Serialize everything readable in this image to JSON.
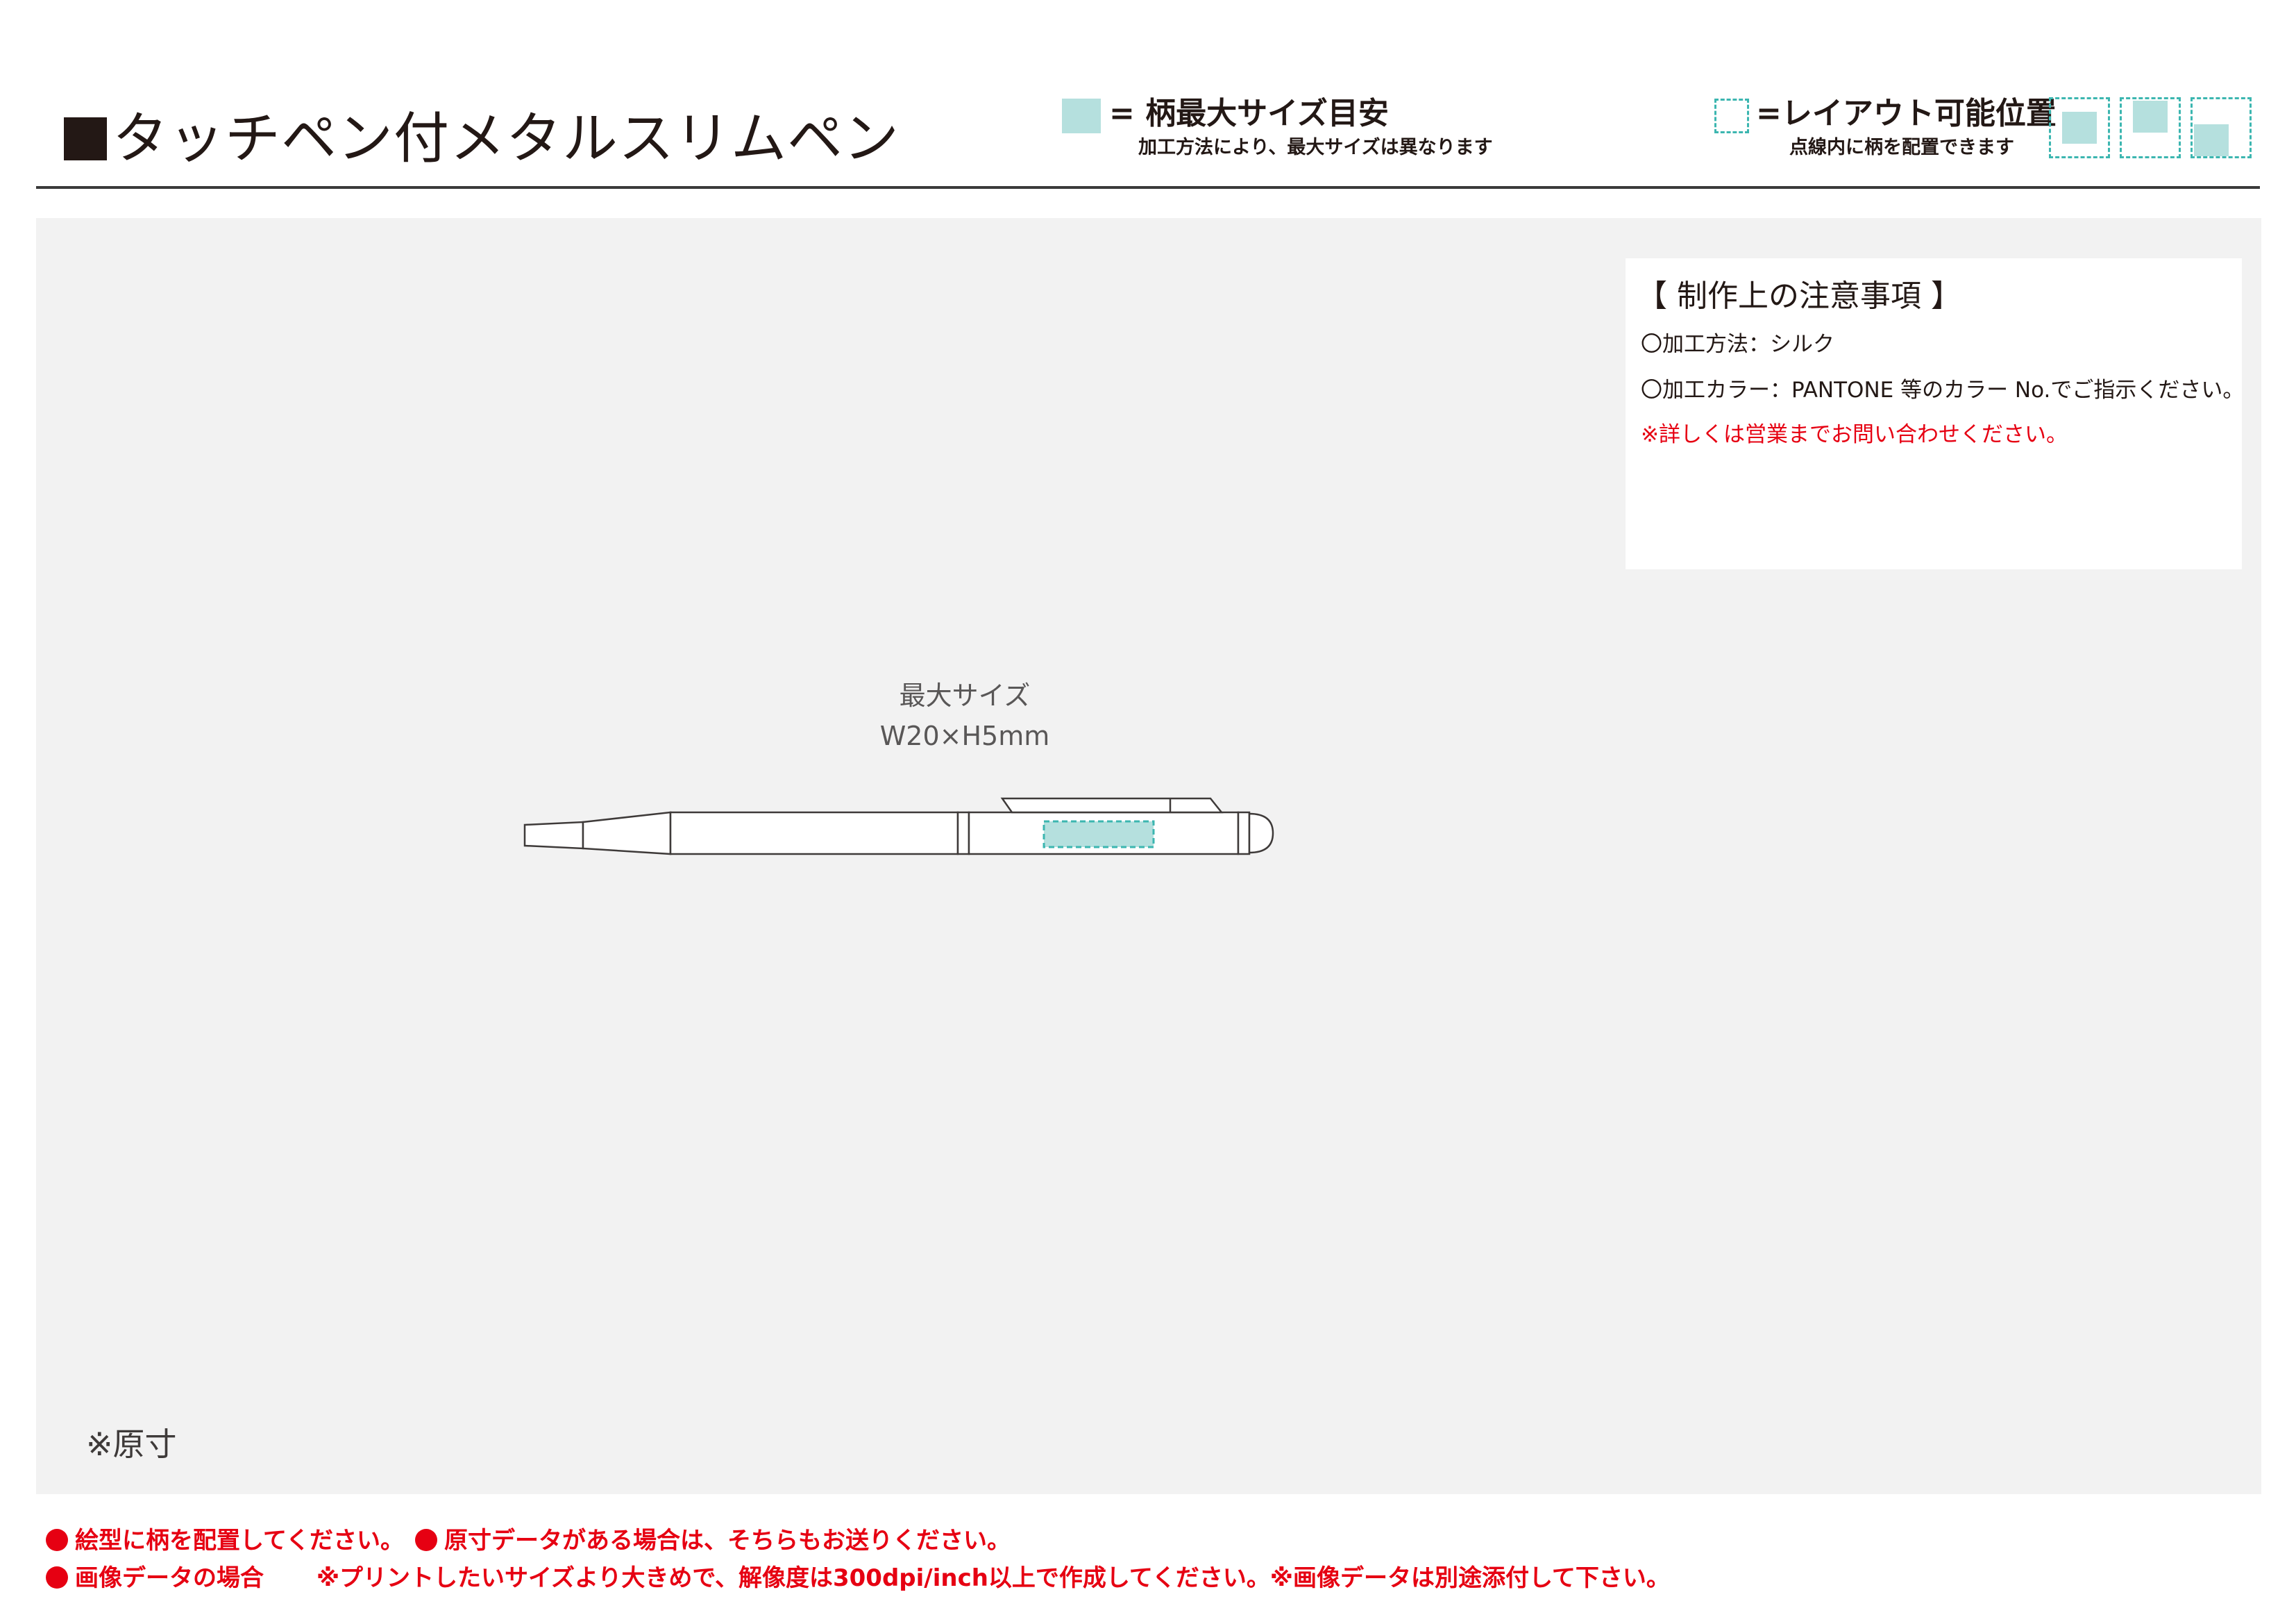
{
  "header": {
    "title": "タッチペン付メタルスリムペン",
    "legend_max": {
      "label": "= 柄最大サイズ目安",
      "note": "加工方法により、最大サイズは異なります"
    },
    "legend_layout": {
      "label": "=レイアウト可能位置",
      "note": "点線内に柄を配置できます"
    }
  },
  "notes": {
    "heading": "【 制作上の注意事項 】",
    "method": "〇加工方法：シルク",
    "color": "〇加工カラー：PANTONE 等のカラー No.でご指示ください。",
    "contact": "※詳しくは営業までお問い合わせください。"
  },
  "artwork": {
    "size_label": "最大サイズ",
    "size_dims": "W20×H5mm",
    "original_size": "※原寸"
  },
  "footer": {
    "line1_a": "絵型に柄を配置してください。",
    "line1_b": "原寸データがある場合は、そちらもお送りください。",
    "line2_a": "画像データの場合",
    "line2_b": "※プリントしたいサイズより大きめで、解像度は300dpi/inch以上で作成してください。※画像データは別途添付して下さい。"
  },
  "colors": {
    "text": "#231815",
    "max_fill": "#b5e0de",
    "layout_dash": "#3cb6b0",
    "panel": "#f2f2f2",
    "warning": "#e60012"
  }
}
